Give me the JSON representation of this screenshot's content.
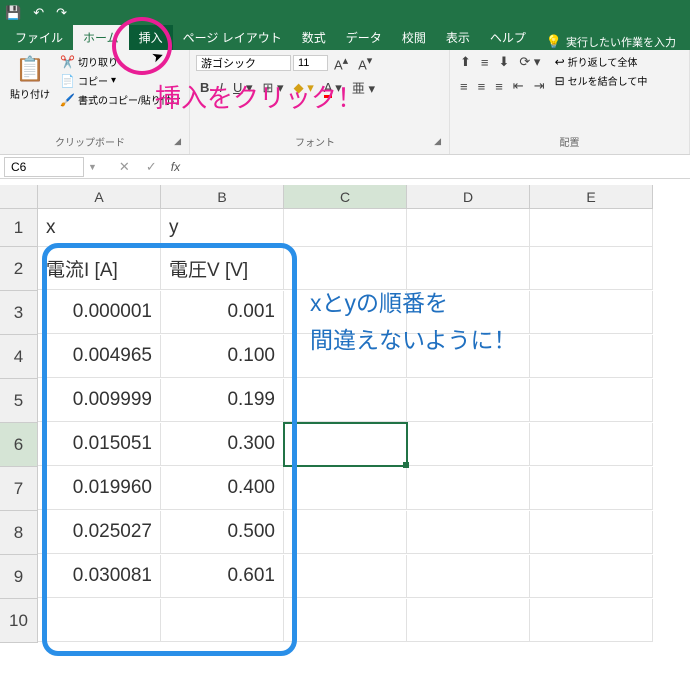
{
  "titlebar": {
    "save_icon": "💾",
    "undo_icon": "↶",
    "redo_icon": "↷"
  },
  "tabs": {
    "file": "ファイル",
    "home": "ホーム",
    "insert": "挿入",
    "page_layout": "ページ レイアウト",
    "formulas": "数式",
    "data": "データ",
    "review": "校閲",
    "view": "表示",
    "help": "ヘルプ",
    "tell_me": "実行したい作業を入力"
  },
  "annotations": {
    "click_insert": "挿入をクリック！",
    "xy_order": "xとyの順番を\n間違えないように！"
  },
  "ribbon": {
    "clipboard": {
      "paste": "貼り付け",
      "cut": "切り取り",
      "copy": "コピー",
      "format_painter": "書式のコピー/貼り付け",
      "group_label": "クリップボード"
    },
    "font": {
      "font_name": "游ゴシック",
      "font_size": "11",
      "group_label": "フォント"
    },
    "alignment": {
      "wrap_text": "折り返して全体",
      "merge_center": "セルを結合して中",
      "group_label": "配置"
    }
  },
  "formula_bar": {
    "name_box": "C6",
    "formula": ""
  },
  "columns": [
    "A",
    "B",
    "C",
    "D",
    "E"
  ],
  "table": {
    "headers": {
      "x_label": "x",
      "y_label": "y"
    },
    "subheaders": {
      "a": "電流I [A]",
      "b": "電圧V [V]"
    },
    "rows": [
      {
        "a": "0.000001",
        "b": "0.001"
      },
      {
        "a": "0.004965",
        "b": "0.100"
      },
      {
        "a": "0.009999",
        "b": "0.199"
      },
      {
        "a": "0.015051",
        "b": "0.300"
      },
      {
        "a": "0.019960",
        "b": "0.400"
      },
      {
        "a": "0.025027",
        "b": "0.500"
      },
      {
        "a": "0.030081",
        "b": "0.601"
      }
    ]
  },
  "selected_cell": "C6"
}
